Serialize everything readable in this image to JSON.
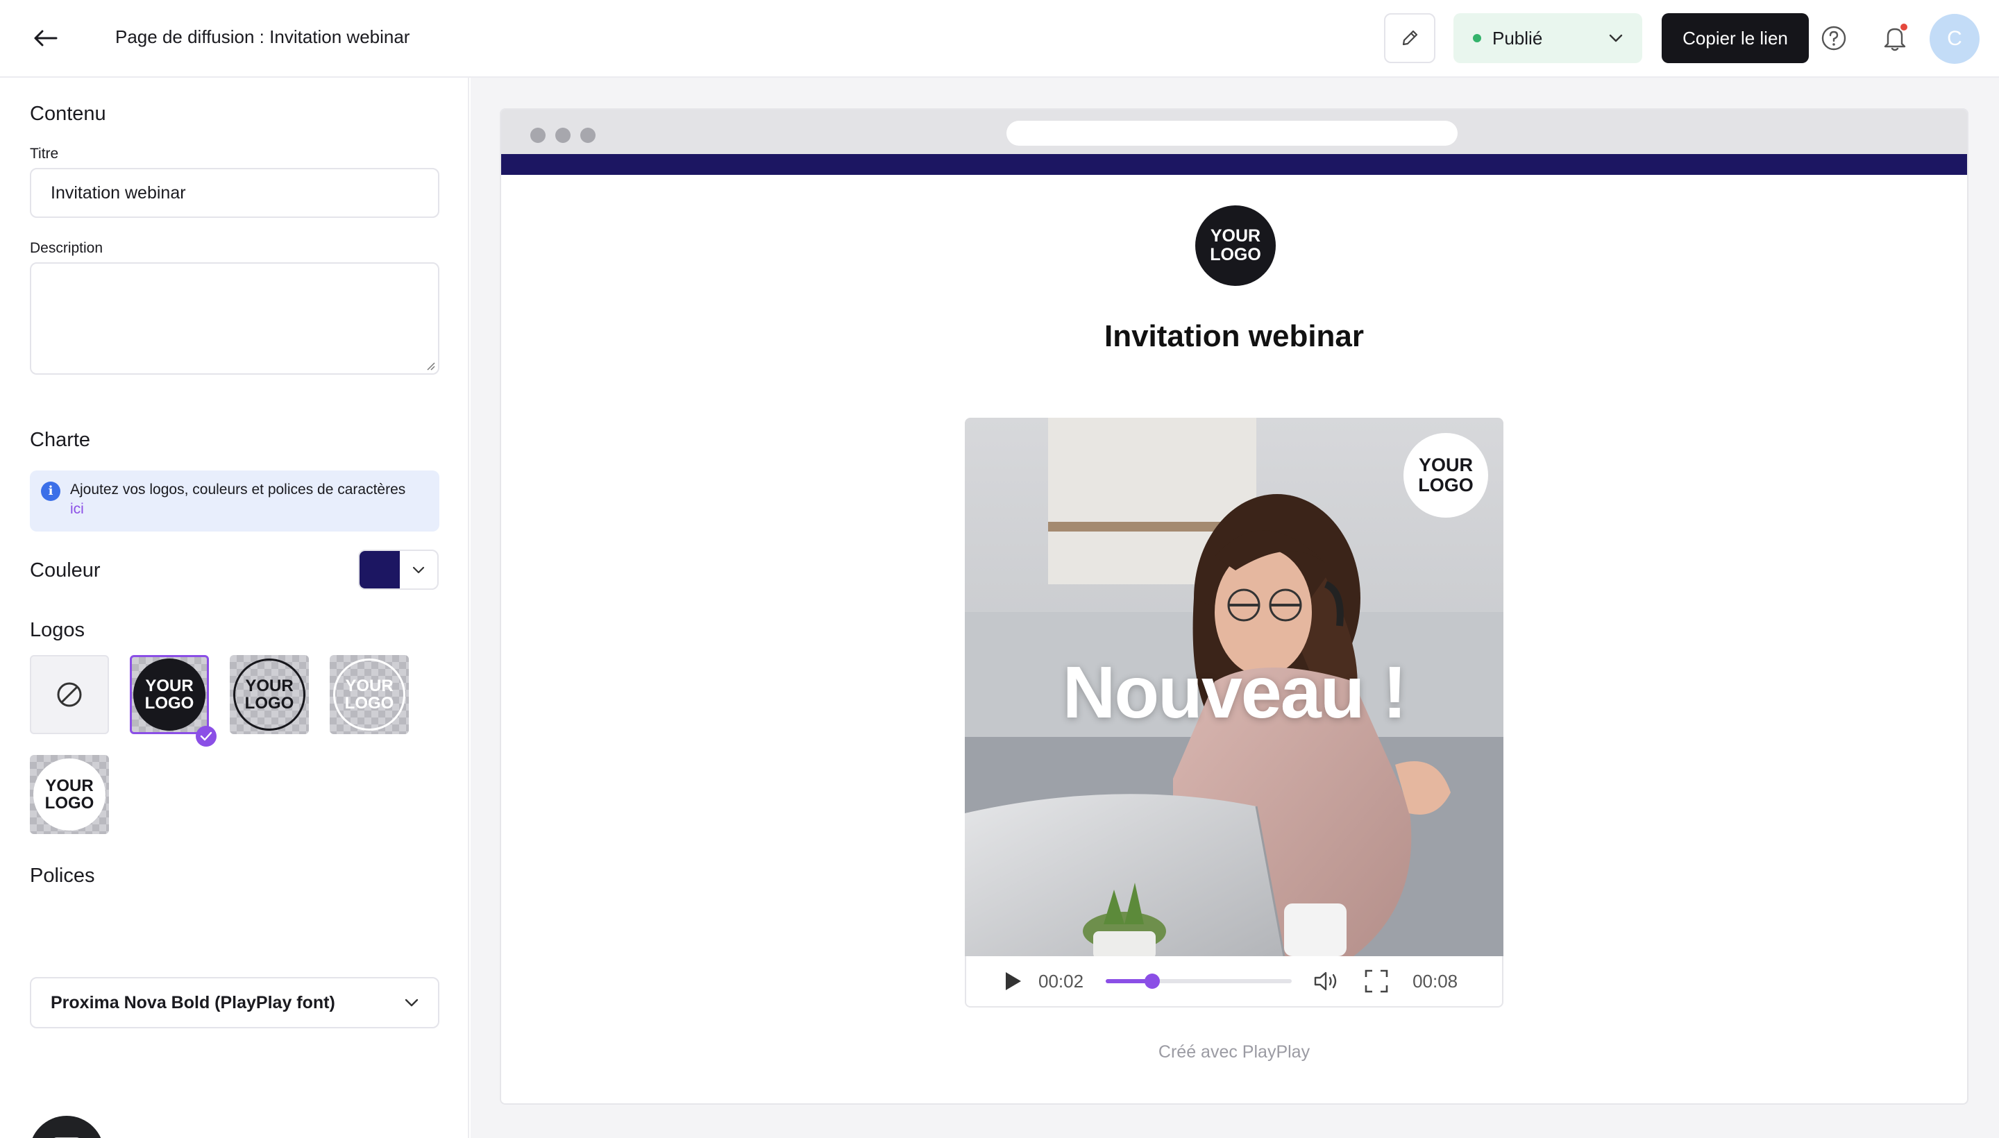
{
  "header": {
    "page_title": "Page de diffusion : Invitation webinar",
    "status_label": "Publié",
    "copy_link_label": "Copier le lien",
    "avatar_initial": "C"
  },
  "sidebar": {
    "content_heading": "Contenu",
    "title_label": "Titre",
    "title_value": "Invitation webinar",
    "description_label": "Description",
    "description_value": "",
    "branding_heading": "Charte",
    "info_text": "Ajoutez vos logos, couleurs et polices de caractères",
    "info_link": "ici",
    "color_label": "Couleur",
    "color_value": "#1c1662",
    "logos_heading": "Logos",
    "logo_text_line1": "YOUR",
    "logo_text_line2": "LOGO",
    "logos": [
      {
        "variant": "none",
        "selected": false
      },
      {
        "variant": "black-filled",
        "selected": true
      },
      {
        "variant": "black-outline",
        "selected": false
      },
      {
        "variant": "white-outline",
        "selected": false
      },
      {
        "variant": "white-filled",
        "selected": false
      }
    ],
    "fonts_heading": "Polices",
    "font_value": "Proxima Nova Bold (PlayPlay font)"
  },
  "preview": {
    "page_heading": "Invitation webinar",
    "logo_line1": "YOUR",
    "logo_line2": "LOGO",
    "video_overlay_text": "Nouveau !",
    "video_logo_line1": "YOUR",
    "video_logo_line2": "LOGO",
    "current_time": "00:02",
    "duration": "00:08",
    "progress": 0.25,
    "credit": "Créé avec PlayPlay"
  },
  "colors": {
    "brand": "#1c1662",
    "accent": "#8b4fe6",
    "published": "#34b36b"
  }
}
